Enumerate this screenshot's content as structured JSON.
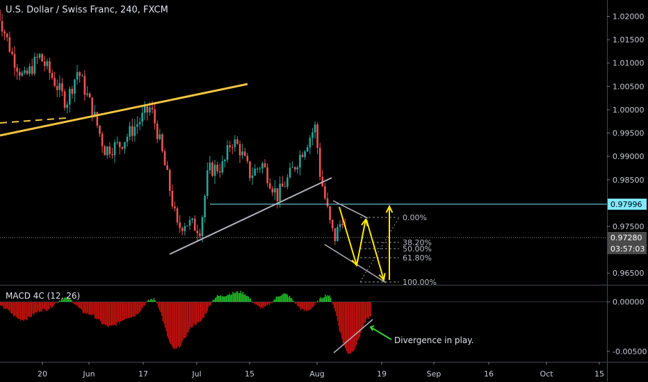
{
  "header": {
    "title": "U.S. Dollar / Swiss Franc, 240, FXCM"
  },
  "macd": {
    "title": "MACD 4C (12, 26)"
  },
  "annotations": {
    "divergence_note": "Divergence in play."
  },
  "price_tags": {
    "level": "0.97996",
    "last": "0.97280",
    "countdown": "03:57:03"
  },
  "fib_levels": [
    "0.00%",
    "38.20%",
    "50.00%",
    "61.80%",
    "100.00%"
  ],
  "colors": {
    "up": "#26a69a",
    "down": "#ef5350",
    "macd_up": "#22c32a",
    "macd_down": "#d0130f",
    "trendline": "#f5c542",
    "arrows": "#ffeb00",
    "level_line": "#7fe8ff",
    "note_arrow": "#39d33a"
  },
  "chart_data": [
    {
      "type": "candlestick",
      "title": "U.S. Dollar / Swiss Franc, 240, FXCM",
      "x_tick_labels": [
        "20",
        "Jun",
        "17",
        "Jul",
        "15",
        "Aug",
        "19",
        "Sep",
        "16",
        "Oct",
        "15"
      ],
      "y_tick_labels": [
        "1.02000",
        "1.01500",
        "1.01000",
        "1.00500",
        "1.00000",
        "0.99500",
        "0.99000",
        "0.98500",
        "0.97500",
        "0.96500"
      ],
      "ylim": [
        0.9625,
        1.0235
      ],
      "grid": false,
      "path_points": [
        {
          "x": "May 10",
          "y": 1.0215
        },
        {
          "x": "May 14",
          "y": 1.0115
        },
        {
          "x": "May 17",
          "y": 1.0065
        },
        {
          "x": "May 21",
          "y": 1.0115
        },
        {
          "x": "May 24",
          "y": 1.0075
        },
        {
          "x": "May 28",
          "y": 1.0015
        },
        {
          "x": "May 31",
          "y": 1.0085
        },
        {
          "x": "Jun 4",
          "y": 0.9995
        },
        {
          "x": "Jun 7",
          "y": 0.9915
        },
        {
          "x": "Jun 11",
          "y": 0.9925
        },
        {
          "x": "Jun 14",
          "y": 0.9955
        },
        {
          "x": "Jun 19",
          "y": 1.0005
        },
        {
          "x": "Jun 21",
          "y": 0.9945
        },
        {
          "x": "Jun 24",
          "y": 0.983
        },
        {
          "x": "Jun 26",
          "y": 0.9745
        },
        {
          "x": "Jun 28",
          "y": 0.976
        },
        {
          "x": "Jul 2",
          "y": 0.9745
        },
        {
          "x": "Jul 4",
          "y": 0.987
        },
        {
          "x": "Jul 8",
          "y": 0.988
        },
        {
          "x": "Jul 10",
          "y": 0.9935
        },
        {
          "x": "Jul 12",
          "y": 0.992
        },
        {
          "x": "Jul 15",
          "y": 0.986
        },
        {
          "x": "Jul 18",
          "y": 0.9885
        },
        {
          "x": "Jul 22",
          "y": 0.9815
        },
        {
          "x": "Jul 25",
          "y": 0.9855
        },
        {
          "x": "Jul 29",
          "y": 0.992
        },
        {
          "x": "Aug 1",
          "y": 0.9965
        },
        {
          "x": "Aug 2",
          "y": 0.987
        },
        {
          "x": "Aug 5",
          "y": 0.9745
        },
        {
          "x": "Aug 6",
          "y": 0.9725
        },
        {
          "x": "Aug 8",
          "y": 0.977
        },
        {
          "x": "Aug 9",
          "y": 0.9728
        }
      ],
      "series": [
        {
          "name": "MACD 4C (12, 26)",
          "values": [
            -0.0005,
            -0.0018,
            -0.0008,
            0.0004,
            -0.0012,
            -0.0025,
            -0.0015,
            0.0003,
            -0.0048,
            -0.0022,
            0.0006,
            0.001,
            -0.0006,
            0.0008,
            -0.0009,
            0.0007,
            -0.0052,
            -0.0015
          ]
        }
      ],
      "macd_y_tick_labels": [
        "0.00000",
        "-0.00500"
      ]
    }
  ]
}
